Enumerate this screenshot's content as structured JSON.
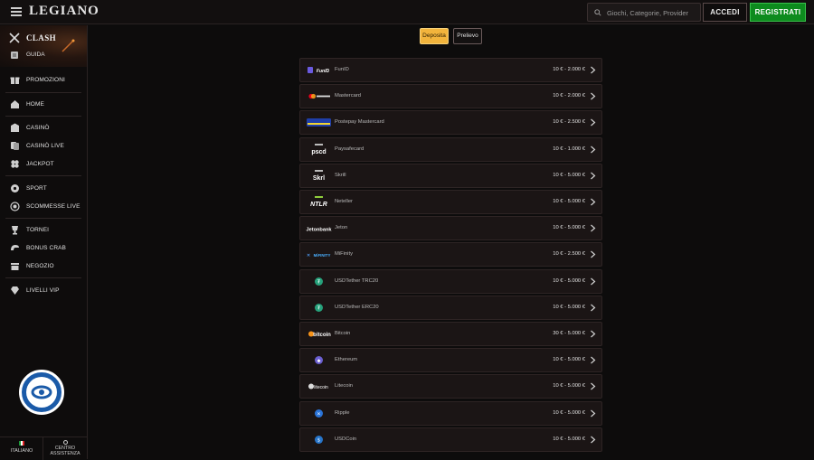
{
  "header": {
    "logo": "LEGIANO",
    "search_placeholder": "Giochi, Categorie, Provider",
    "login_label": "ACCEDI",
    "register_label": "REGISTRATI"
  },
  "sidebar": {
    "clash_label": "CLASH",
    "guida_label": "GUIDA",
    "items": [
      {
        "label": "PROMOZIONI",
        "icon": "gift-icon"
      },
      {
        "label": "HOME",
        "icon": "home-icon"
      },
      {
        "label": "CASINÒ",
        "icon": "casino-icon"
      },
      {
        "label": "CASINÒ LIVE",
        "icon": "cards-icon"
      },
      {
        "label": "JACKPOT",
        "icon": "clover-icon"
      },
      {
        "label": "SPORT",
        "icon": "ball-icon"
      },
      {
        "label": "SCOMMESSE LIVE",
        "icon": "live-icon"
      },
      {
        "label": "TORNEI",
        "icon": "trophy-icon"
      },
      {
        "label": "BONUS CRAB",
        "icon": "crab-icon"
      },
      {
        "label": "NEGOZIO",
        "icon": "shop-icon"
      },
      {
        "label": "LIVELLI VIP",
        "icon": "diamond-icon"
      }
    ],
    "language_label": "ITALIANO",
    "help_label_1": "CENTRO",
    "help_label_2": "ASSISTENZA"
  },
  "tabs": {
    "deposit": "Deposita",
    "withdraw": "Prelievo",
    "active": "Deposita"
  },
  "methods": [
    {
      "name": "FunID",
      "limits": "10 € - 2.000 €",
      "logo": "FunID"
    },
    {
      "name": "Mastercard",
      "limits": "10 € - 2.000 €",
      "logo": "mastercard"
    },
    {
      "name": "Postepay Mastercard",
      "limits": "10 € - 2.500 €",
      "logo": "postepay"
    },
    {
      "name": "Paysafecard",
      "limits": "10 € - 1.000 €",
      "logo": "pscd"
    },
    {
      "name": "Skrill",
      "limits": "10 € - 5.000 €",
      "logo": "Skrl"
    },
    {
      "name": "Neteller",
      "limits": "10 € - 5.000 €",
      "logo": "NTLR"
    },
    {
      "name": "Jeton",
      "limits": "10 € - 5.000 €",
      "logo": "Jetonbank"
    },
    {
      "name": "MiFinity",
      "limits": "10 € - 2.500 €",
      "logo": "MiFINITY"
    },
    {
      "name": "USDTether TRC20",
      "limits": "10 € - 5.000 €",
      "logo": "tether"
    },
    {
      "name": "USDTether ERC20",
      "limits": "10 € - 5.000 €",
      "logo": "tether"
    },
    {
      "name": "Bitcoin",
      "limits": "30 € - 5.000 €",
      "logo": "bitcoin"
    },
    {
      "name": "Ethereum",
      "limits": "10 € - 5.000 €",
      "logo": "ethereum"
    },
    {
      "name": "Litecoin",
      "limits": "10 € - 5.000 €",
      "logo": "litecoin"
    },
    {
      "name": "Ripple",
      "limits": "10 € - 5.000 €",
      "logo": "ripple"
    },
    {
      "name": "USDCoin",
      "limits": "10 € - 5.000 €",
      "logo": "usdc"
    }
  ],
  "colors": {
    "accent_gold": "#f2b43c",
    "register_green": "#0d8b1e",
    "background": "#0d0c0c"
  }
}
